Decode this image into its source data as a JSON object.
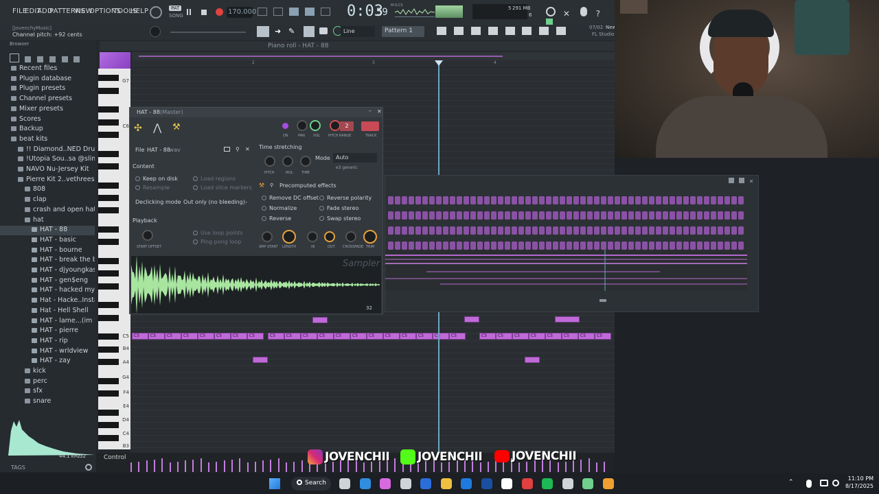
{
  "menu": [
    "FILE",
    "EDIT",
    "ADD",
    "PATTERNS",
    "VIEW",
    "OPTIONS",
    "TOOLS",
    "HELP"
  ],
  "transport": {
    "pat_label": "PAT",
    "song_label": "SONG",
    "tempo": "170.000",
    "time": "0:03",
    "time_small": "59",
    "time_unit": "M:S:CS"
  },
  "perf": {
    "value1": "5",
    "memory": "291 MB",
    "value2": "6"
  },
  "studio": {
    "date": "07/02",
    "news": "New",
    "product": "FL Studio"
  },
  "hint": {
    "line1": "[JovenchyMusic]",
    "line2": "Channel pitch: +92 cents"
  },
  "toolbar": {
    "snap": "Line",
    "pattern": "Pattern 1"
  },
  "browser": {
    "title": "Browser",
    "items": [
      {
        "label": "Recent files",
        "depth": 0
      },
      {
        "label": "Plugin database",
        "depth": 0
      },
      {
        "label": "Plugin presets",
        "depth": 0
      },
      {
        "label": "Channel presets",
        "depth": 0
      },
      {
        "label": "Mixer presets",
        "depth": 0
      },
      {
        "label": "Scores",
        "depth": 0
      },
      {
        "label": "Backup",
        "depth": 0
      },
      {
        "label": "beat kits",
        "depth": 0
      },
      {
        "label": "!! Diamond..NED Drum Kit",
        "depth": 1
      },
      {
        "label": "!Utopia Sou..sa @slimejax",
        "depth": 1
      },
      {
        "label": "NAVO Nu-Jersey Kit",
        "depth": 1
      },
      {
        "label": "Pierre Kit 2..vethreesosa",
        "depth": 1
      },
      {
        "label": "808",
        "depth": 2
      },
      {
        "label": "clap",
        "depth": 2
      },
      {
        "label": "crash and open hat",
        "depth": 2
      },
      {
        "label": "hat",
        "depth": 2
      },
      {
        "label": "HAT - 88",
        "depth": 3
      },
      {
        "label": "HAT - basic",
        "depth": 3
      },
      {
        "label": "HAT - bourne",
        "depth": 3
      },
      {
        "label": "HAT - break the bank",
        "depth": 3
      },
      {
        "label": "HAT - djyoungkash",
        "depth": 3
      },
      {
        "label": "HAT - gen$eng",
        "depth": 3
      },
      {
        "label": "HAT - hacked my ig",
        "depth": 3
      },
      {
        "label": "Hat - Hacke..Instagram",
        "depth": 3
      },
      {
        "label": "Hat - Hell Shell",
        "depth": 3
      },
      {
        "label": "HAT - lame...(im white)",
        "depth": 3
      },
      {
        "label": "HAT - pierre",
        "depth": 3
      },
      {
        "label": "HAT - rip",
        "depth": 3
      },
      {
        "label": "HAT - wrldview",
        "depth": 3
      },
      {
        "label": "HAT - zay",
        "depth": 3
      },
      {
        "label": "kick",
        "depth": 2
      },
      {
        "label": "perc",
        "depth": 2
      },
      {
        "label": "sfx",
        "depth": 2
      },
      {
        "label": "snare",
        "depth": 2
      }
    ],
    "selected_index": 16,
    "sample_rate": "44.1 kHz",
    "bit_depth": "32",
    "tags": "TAGS"
  },
  "pianoroll": {
    "title": "Piano roll - HAT - 88",
    "bars": [
      "2",
      "3",
      "4"
    ],
    "keys": [
      "G7",
      "C6",
      "C5",
      "B4",
      "A4",
      "G4",
      "F4",
      "E4",
      "D4",
      "C4",
      "B3"
    ],
    "note_label": "C5",
    "control_label": "Control"
  },
  "sampler": {
    "title": "HAT - 88",
    "title_suffix": "(Master)",
    "knob_labels": [
      "ON",
      "PAN",
      "VOL",
      "PITCH",
      "RANGE",
      "TRACK"
    ],
    "pitch_range": "2",
    "file_label": "File",
    "file_name": "HAT - 88",
    "file_ext": ".wav",
    "content_label": "Content",
    "keep_on_disk": "Keep on disk",
    "resample": "Resample",
    "load_regions": "Load regions",
    "load_slice_markers": "Load slice markers",
    "declicking_label": "Declicking mode",
    "declicking_value": "Out only (no bleeding)",
    "playback_label": "Playback",
    "start_offset": "START OFFSET",
    "use_loop_points": "Use loop points",
    "ping_pong_loop": "Ping pong loop",
    "time_stretching": "Time stretching",
    "ts_knobs": [
      "PITCH",
      "MUL",
      "TIME"
    ],
    "mode_label": "Mode",
    "mode_value": "Auto",
    "mode_sub": "e3 generic",
    "precomputed": "Precomputed effects",
    "effects_left": [
      "Remove DC offset",
      "Normalize",
      "Reverse"
    ],
    "effects_right": [
      "Reverse polarity",
      "Fade stereo",
      "Swap stereo"
    ],
    "fx_knobs": [
      "SMP START",
      "LENGTH",
      "IN",
      "OUT",
      "CROSSFADE",
      "TRIM"
    ],
    "watermark": "Sampler",
    "corner_value": "32"
  },
  "overlay": {
    "instagram": "JOVENCHII",
    "kick": "JOVENCHII",
    "youtube": "JOVENCHII"
  },
  "taskbar": {
    "search": "Search",
    "time": "11:10 PM",
    "date": "8/17/2025"
  }
}
